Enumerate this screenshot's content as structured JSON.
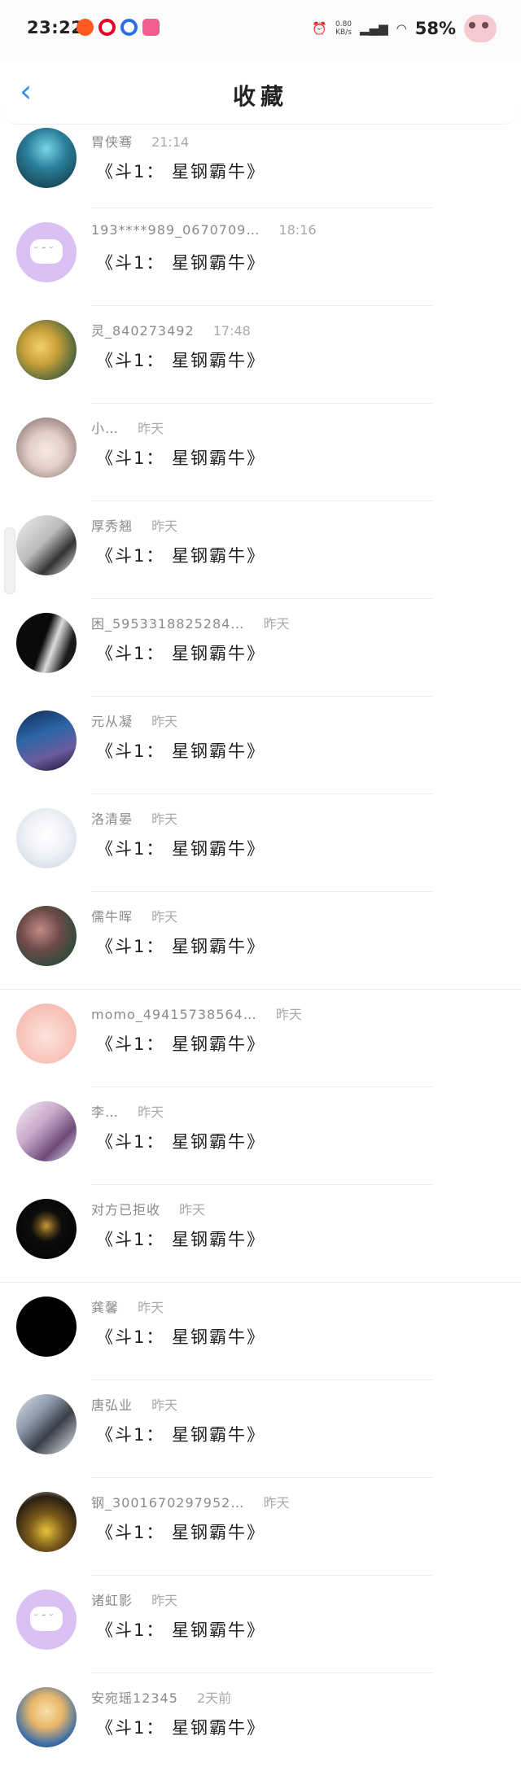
{
  "status_bar": {
    "time": "23:22",
    "net_speed": "0.80",
    "net_unit": "KB/s",
    "battery": "58%"
  },
  "header": {
    "title": "收藏"
  },
  "list": [
    {
      "name": "胃侠骞",
      "time": "21:14",
      "message": "《斗1： 星钢霸牛》",
      "avatar": "ocean-diver"
    },
    {
      "name": "193****989_0670709…",
      "time": "18:16",
      "message": "《斗1： 星钢霸牛》",
      "avatar": "default-bubble"
    },
    {
      "name": "灵_840273492",
      "time": "17:48",
      "message": "《斗1： 星钢霸牛》",
      "avatar": "anime-girl-yellow"
    },
    {
      "name": "小…",
      "time": "昨天",
      "message": "《斗1： 星钢霸牛》",
      "avatar": "anime-chibi"
    },
    {
      "name": "厚秀翘",
      "time": "昨天",
      "message": "《斗1： 星钢霸牛》",
      "avatar": "bw-portrait"
    },
    {
      "name": "困_5953318825284…",
      "time": "昨天",
      "message": "《斗1： 星钢霸牛》",
      "avatar": "black-white-face"
    },
    {
      "name": "元从凝",
      "time": "昨天",
      "message": "《斗1： 星钢霸牛》",
      "avatar": "night-sky"
    },
    {
      "name": "洛清晏",
      "time": "昨天",
      "message": "《斗1： 星钢霸牛》",
      "avatar": "white-anime"
    },
    {
      "name": "儒牛晖",
      "time": "昨天",
      "message": "《斗1： 星钢霸牛》",
      "avatar": "couple-photo"
    },
    {
      "name": "momo_49415738564…",
      "time": "昨天",
      "message": "《斗1： 星钢霸牛》",
      "avatar": "pink-blob"
    },
    {
      "name": "李…",
      "time": "昨天",
      "message": "《斗1： 星钢霸牛》",
      "avatar": "girl-purple"
    },
    {
      "name": "对方已拒收",
      "time": "昨天",
      "message": "《斗1： 星钢霸牛》",
      "avatar": "moon-emblem"
    },
    {
      "name": "龚馨",
      "time": "昨天",
      "message": "《斗1： 星钢霸牛》",
      "avatar": "solid-black"
    },
    {
      "name": "唐弘业",
      "time": "昨天",
      "message": "《斗1： 星钢霸牛》",
      "avatar": "couple-hug"
    },
    {
      "name": "钢_3001670297952…",
      "time": "昨天",
      "message": "《斗1： 星钢霸牛》",
      "avatar": "girl-yellow-jacket"
    },
    {
      "name": "诸虹影",
      "time": "昨天",
      "message": "《斗1： 星钢霸牛》",
      "avatar": "default-bubble"
    },
    {
      "name": "安宛瑶12345",
      "time": "2天前",
      "message": "《斗1： 星钢霸牛》",
      "avatar": "blonde-girl"
    }
  ]
}
